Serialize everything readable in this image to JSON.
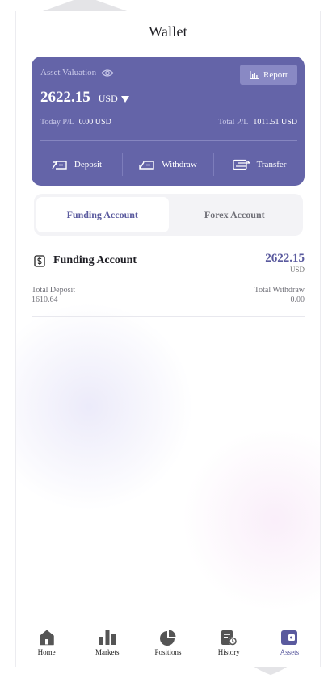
{
  "header": {
    "title": "Wallet"
  },
  "card": {
    "asset_label": "Asset Valuation",
    "report_label": "Report",
    "balance": "2622.15",
    "currency": "USD",
    "today_pl_label": "Today P/L",
    "today_pl_value": "0.00 USD",
    "total_pl_label": "Total P/L",
    "total_pl_value": "1011.51 USD",
    "actions": [
      {
        "label": "Deposit",
        "icon": "deposit-icon"
      },
      {
        "label": "Withdraw",
        "icon": "withdraw-icon"
      },
      {
        "label": "Transfer",
        "icon": "transfer-icon"
      }
    ],
    "color": "#6464a8"
  },
  "tabs": [
    {
      "label": "Funding Account",
      "active": true
    },
    {
      "label": "Forex Account",
      "active": false
    }
  ],
  "account": {
    "name": "Funding Account",
    "icon": "dollar-document-icon",
    "amount": "2622.15",
    "currency": "USD",
    "total_deposit_label": "Total Deposit",
    "total_deposit_value": "1610.64",
    "total_withdraw_label": "Total Withdraw",
    "total_withdraw_value": "0.00"
  },
  "nav": [
    {
      "label": "Home",
      "icon": "home-icon",
      "active": false
    },
    {
      "label": "Markets",
      "icon": "bar-chart-icon",
      "active": false
    },
    {
      "label": "Positions",
      "icon": "pie-chart-icon",
      "active": false
    },
    {
      "label": "History",
      "icon": "history-icon",
      "active": false
    },
    {
      "label": "Assets",
      "icon": "wallet-icon",
      "active": true
    }
  ],
  "accent_color": "#5a5a9e"
}
